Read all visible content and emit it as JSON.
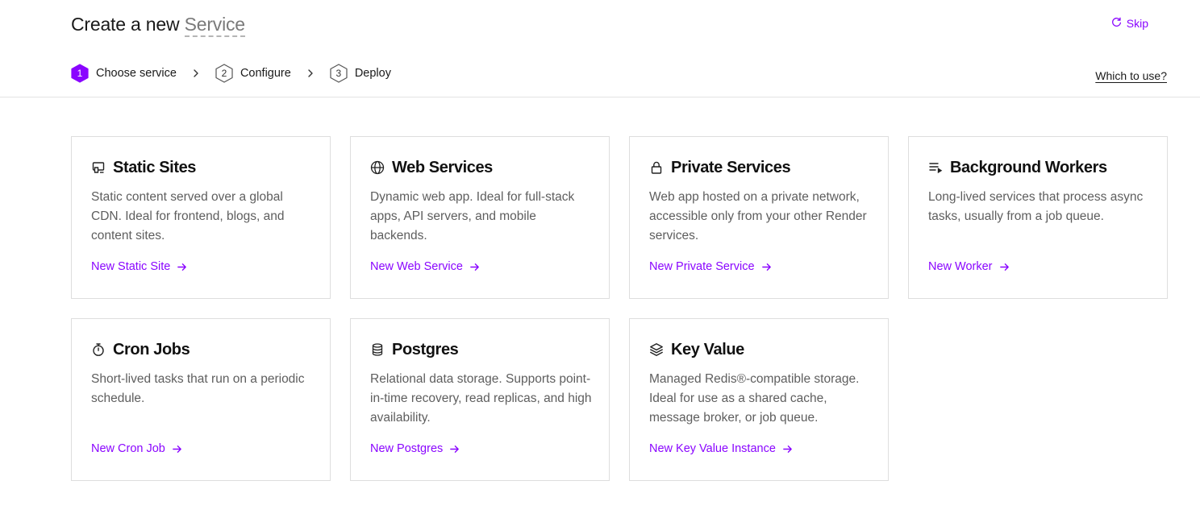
{
  "header": {
    "title_prefix": "Create a new ",
    "title_highlight": "Service",
    "skip_label": "Skip",
    "help_link": "Which to use?"
  },
  "steps": [
    {
      "number": "1",
      "label": "Choose service",
      "active": true
    },
    {
      "number": "2",
      "label": "Configure",
      "active": false
    },
    {
      "number": "3",
      "label": "Deploy",
      "active": false
    }
  ],
  "cards": [
    {
      "icon": "static-site-icon",
      "title": "Static Sites",
      "description": "Static content served over a global CDN. Ideal for frontend, blogs, and content sites.",
      "link": "New Static Site"
    },
    {
      "icon": "globe-icon",
      "title": "Web Services",
      "description": "Dynamic web app. Ideal for full-stack apps, API servers, and mobile backends.",
      "link": "New Web Service"
    },
    {
      "icon": "lock-icon",
      "title": "Private Services",
      "description": "Web app hosted on a private network, accessible only from your other Render services.",
      "link": "New Private Service"
    },
    {
      "icon": "queue-list-icon",
      "title": "Background Workers",
      "description": "Long-lived services that process async tasks, usually from a job queue.",
      "link": "New Worker"
    },
    {
      "icon": "stopwatch-icon",
      "title": "Cron Jobs",
      "description": "Short-lived tasks that run on a periodic schedule.",
      "link": "New Cron Job"
    },
    {
      "icon": "database-icon",
      "title": "Postgres",
      "description": "Relational data storage. Supports point-in-time recovery, read replicas, and high availability.",
      "link": "New Postgres"
    },
    {
      "icon": "layers-icon",
      "title": "Key Value",
      "description": "Managed Redis®-compatible storage. Ideal for use as a shared cache, message broker, or job queue.",
      "link": "New Key Value Instance"
    }
  ],
  "colors": {
    "accent": "#8a05ff",
    "text": "#1a1a1a",
    "muted": "#5e5e5e",
    "border": "#dedede"
  }
}
